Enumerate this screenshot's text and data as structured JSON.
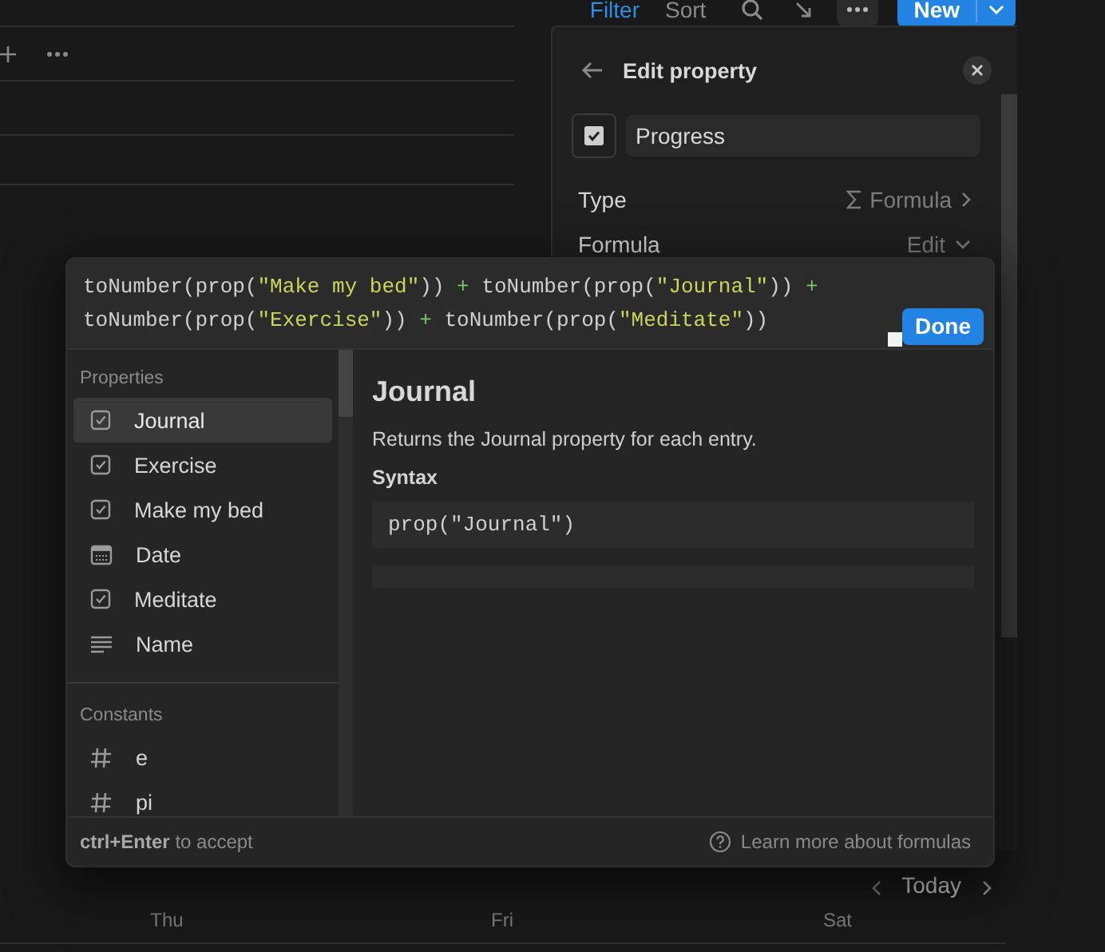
{
  "toolbar": {
    "filter": "Filter",
    "sort": "Sort",
    "new_button": "New"
  },
  "panel": {
    "title": "Edit property",
    "name_value": "Progress",
    "rows": [
      {
        "label": "Type",
        "value": "Formula",
        "kind": "type"
      },
      {
        "label": "Formula",
        "value": "Edit",
        "kind": "formula"
      }
    ]
  },
  "formula_editor": {
    "formula": "toNumber(prop(\"Make my bed\")) + toNumber(prop(\"Journal\")) + toNumber(prop(\"Exercise\")) + toNumber(prop(\"Meditate\"))",
    "done_button": "Done"
  },
  "properties": {
    "heading": "Properties",
    "items": [
      {
        "label": "Journal",
        "kind": "checkbox",
        "selected": true
      },
      {
        "label": "Exercise",
        "kind": "checkbox",
        "selected": false
      },
      {
        "label": "Make my bed",
        "kind": "checkbox",
        "selected": false
      },
      {
        "label": "Date",
        "kind": "date",
        "selected": false
      },
      {
        "label": "Meditate",
        "kind": "checkbox",
        "selected": false
      },
      {
        "label": "Name",
        "kind": "text",
        "selected": false
      }
    ]
  },
  "constants": {
    "heading": "Constants",
    "items": [
      {
        "label": "e",
        "selected": false
      },
      {
        "label": "pi",
        "selected": false
      }
    ]
  },
  "detail": {
    "title": "Journal",
    "description": "Returns the Journal property for each entry.",
    "syntax_heading": "Syntax",
    "syntax": "prop(\"Journal\")"
  },
  "footer": {
    "hint": "**ctrl+Enter** to accept",
    "link": "Learn more about formulas"
  },
  "calendar": {
    "today": "Today",
    "days": [
      "Thu",
      "Fri",
      "Sat"
    ]
  }
}
